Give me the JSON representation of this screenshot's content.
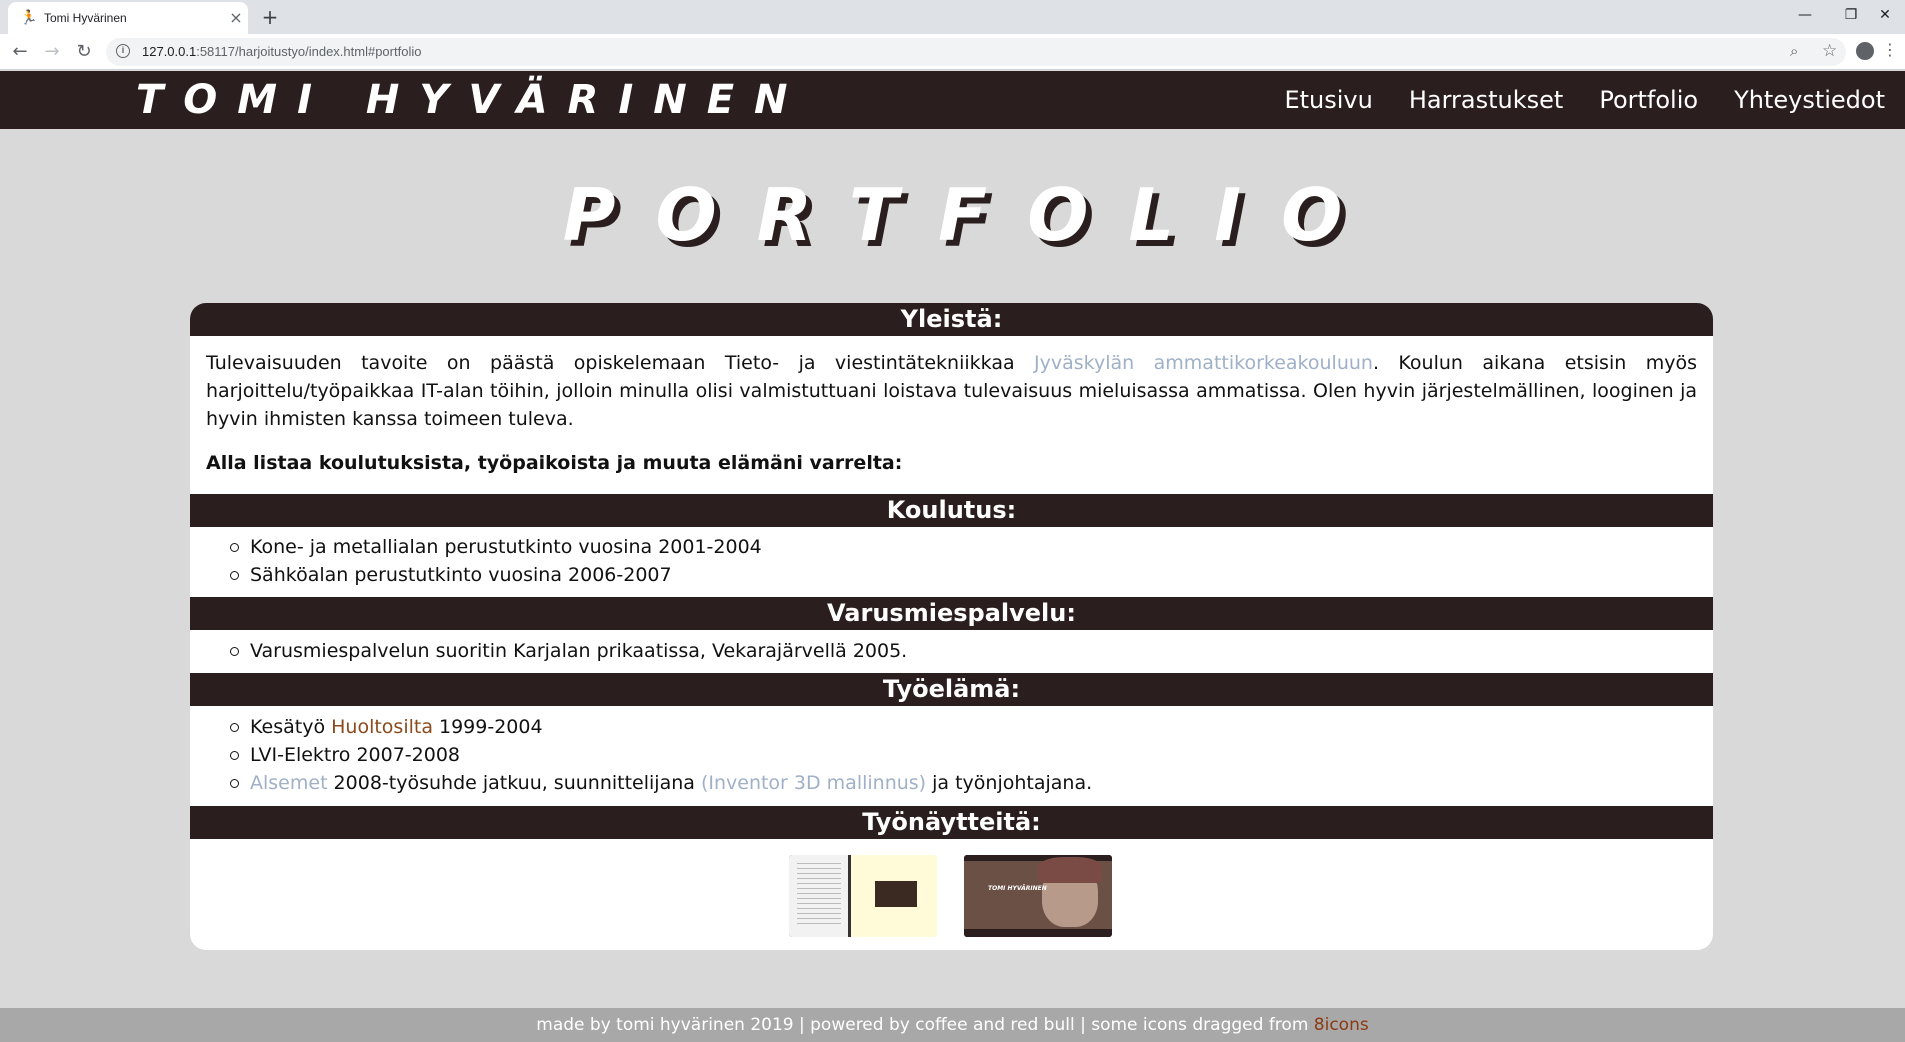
{
  "browser": {
    "tab_title": "Tomi Hyvärinen",
    "tab_close": "×",
    "new_tab": "+",
    "url_host": "127.0.0.1",
    "url_rest": ":58117/harjoitustyo/index.html#portfolio",
    "icons": [
      "back-icon",
      "forward-icon",
      "reload-icon",
      "info-icon",
      "zoom-icon",
      "star-icon",
      "profile-icon",
      "menu-icon"
    ]
  },
  "header": {
    "site_title": "TOMI HYVÄRINEN",
    "nav": [
      {
        "label": "Etusivu"
      },
      {
        "label": "Harrastukset"
      },
      {
        "label": "Portfolio"
      },
      {
        "label": "Yhteystiedot"
      }
    ]
  },
  "page": {
    "heading": "PORTFOLIO"
  },
  "sections": {
    "general": {
      "title": "Yleistä:",
      "text_before": "Tulevaisuuden tavoite on päästä opiskelemaan Tieto- ja viestintätekniikkaa ",
      "link": "Jyväskylän ammattikorkeakouluun",
      "text_after": ". Koulun aikana etsisin myös harjoittelu/työpaikkaa IT-alan töihin, jolloin minulla olisi valmistuttuani loistava tulevaisuus mieluisassa ammatissa. Olen hyvin järjestelmällinen, looginen ja hyvin ihmisten kanssa toimeen tuleva.",
      "intro": "Alla listaa koulutuksista, työpaikoista ja muuta elämäni varrelta:"
    },
    "education": {
      "title": "Koulutus:",
      "items": [
        "Kone- ja metallialan perustutkinto vuosina 2001-2004",
        "Sähköalan perustutkinto vuosina 2006-2007"
      ]
    },
    "military": {
      "title": "Varusmiespalvelu:",
      "items": [
        "Varusmiespalvelun suoritin Karjalan prikaatissa, Vekarajärvellä 2005."
      ]
    },
    "work": {
      "title": "Työelämä:",
      "item1_pre": "Kesätyö ",
      "item1_link": "Huoltosilta",
      "item1_post": " 1999-2004",
      "item2": "LVI-Elektro 2007-2008",
      "item3_link": "Alsemet",
      "item3_mid": " 2008-työsuhde jatkuu, suunnittelijana ",
      "item3_link2": "(Inventor 3D mallinnus)",
      "item3_post": " ja työnjohtajana."
    },
    "samples": {
      "title": "Työnäytteitä:",
      "thumb2_text": "TOMI HYVÄRINEN"
    }
  },
  "footer": {
    "text": "made by tomi hyvärinen 2019 | powered by coffee and red bull | some icons dragged from ",
    "link": "8icons"
  },
  "colors": {
    "header_bg": "#2a1e1e",
    "page_bg": "#d9d9d9",
    "link_blue": "#9fb0c7",
    "link_brown": "#8b4a1c",
    "footer_bg": "#a8a8a8"
  }
}
